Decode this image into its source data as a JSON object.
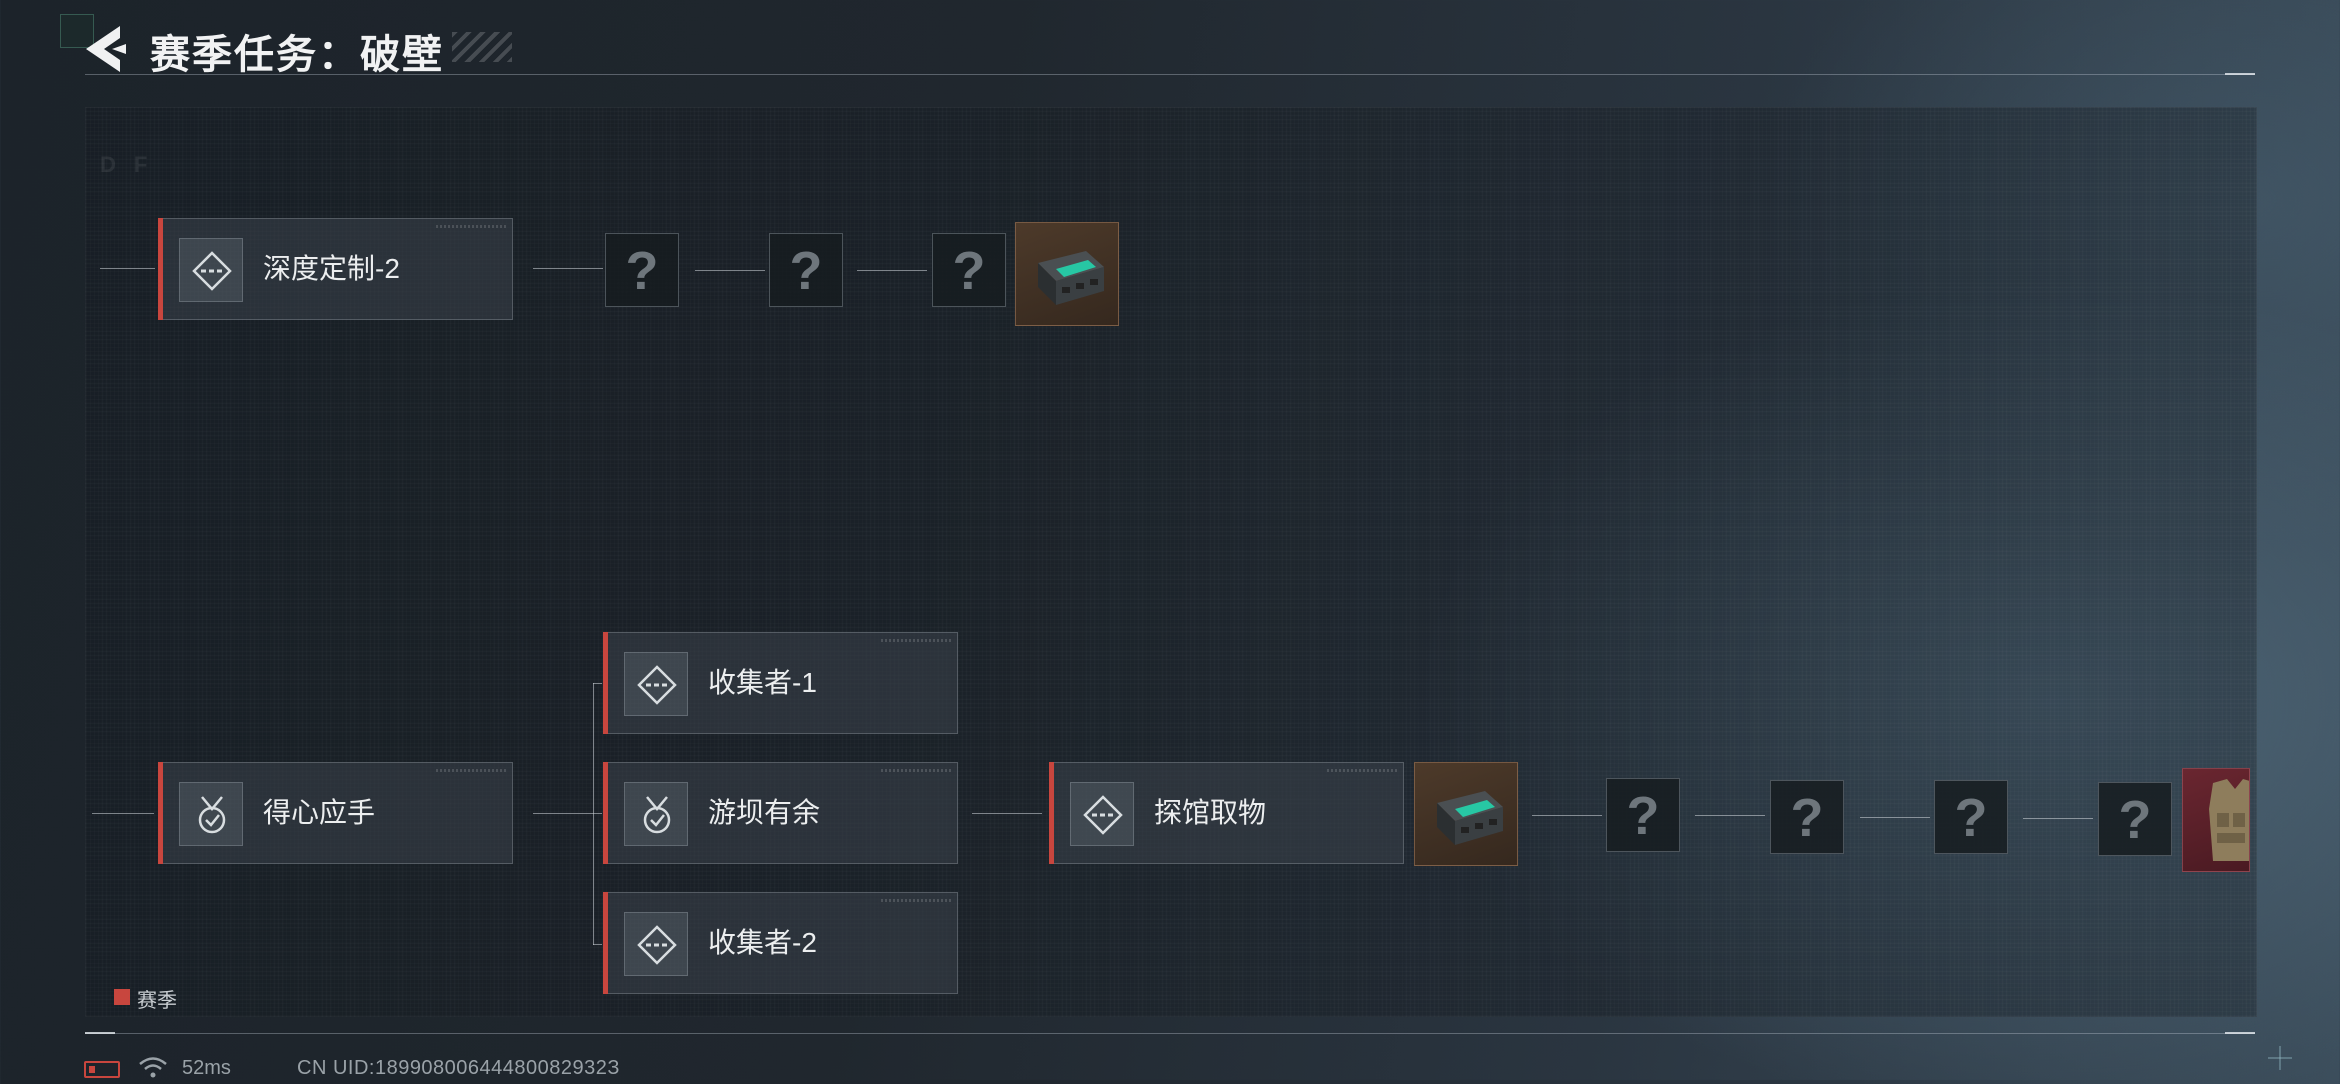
{
  "header": {
    "title": "赛季任务：破壁"
  },
  "tasks": {
    "deep_custom": {
      "label": "深度定制-2",
      "icon": "diamond-dash-icon"
    },
    "handy": {
      "label": "得心应手",
      "icon": "medal-check-icon"
    },
    "collector1": {
      "label": "收集者-1",
      "icon": "diamond-dash-icon"
    },
    "spare": {
      "label": "游坝有余",
      "icon": "medal-check-icon"
    },
    "collector2": {
      "label": "收集者-2",
      "icon": "diamond-dash-icon"
    },
    "explore": {
      "label": "探馆取物",
      "icon": "diamond-dash-icon"
    }
  },
  "mystery": {
    "symbol": "?"
  },
  "rewards": {
    "top_chest": "ammo-case-icon",
    "mid_chest": "ammo-case-icon",
    "armor": "body-armor-icon"
  },
  "legend": {
    "label": "赛季",
    "color": "#c8463e"
  },
  "status": {
    "ping": "52ms",
    "uid": "CN UID:18990800644480082932З"
  }
}
